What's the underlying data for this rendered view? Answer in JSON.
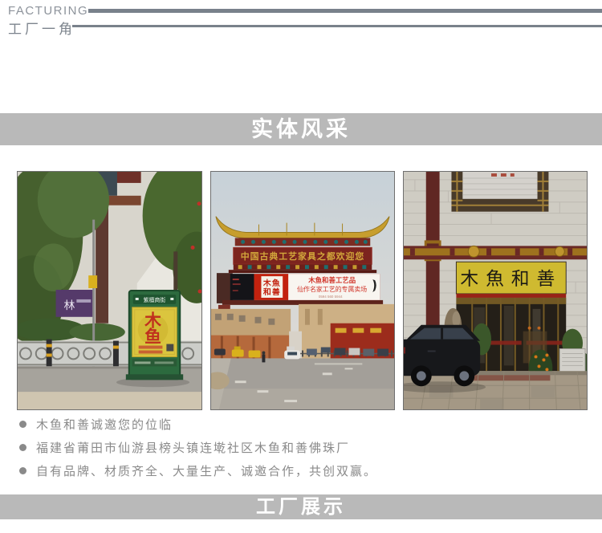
{
  "header": {
    "en": "FACTURING",
    "zh": "工厂一角"
  },
  "sections": {
    "showcase": "实体风采",
    "factory": "工厂展示"
  },
  "bullets": [
    "木鱼和善诚邀您的位临",
    "福建省莆田市仙游县榜头镇连墘社区木鱼和善佛珠厂",
    "自有品牌、材质齐全、大量生产、诚邀合作，共创双赢。"
  ],
  "photos": {
    "street": {
      "kiosk_header": "紫檀商街",
      "kiosk_char1": "木",
      "kiosk_char2": "鱼",
      "side_sign": "林"
    },
    "archway": {
      "plaque": "中国古典工艺家具之都欢迎您",
      "logo_row1": "木魚",
      "logo_row2": "和善",
      "ad_line1": "木鱼和善工艺品",
      "ad_line2": "仙作名家工艺的专属卖场",
      "ad_line3": "0594 560 5944"
    },
    "storefront": {
      "sign": "木魚和善"
    }
  },
  "colors": {
    "banner_bg": "#b9b9b9",
    "rule_gray": "#79818b",
    "text_gray": "#8a8a8a",
    "brand_red": "#c2220f",
    "sign_yellow": "#d9c232"
  }
}
